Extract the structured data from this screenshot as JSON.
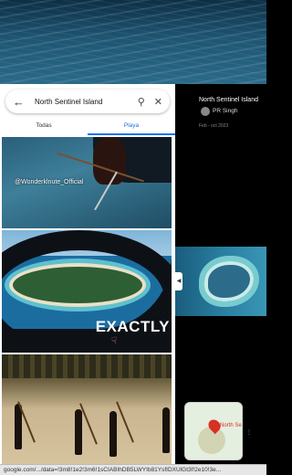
{
  "search": {
    "query": "North Sentinel Island",
    "back_icon": "arrow-left-icon",
    "search_icon": "search-icon",
    "close_icon": "close-icon"
  },
  "tabs": [
    {
      "label": "Todas",
      "active": false
    },
    {
      "label": "Playa",
      "active": true
    }
  ],
  "images": {
    "first_watermark": "@Wonderklnute_Official",
    "second_caption": "EXACTLY"
  },
  "side_panel": {
    "title": "North Sentinel Island",
    "author": "PR Singh",
    "date": "Feb - oct 2023"
  },
  "map": {
    "label": "North Se"
  },
  "url": "google.com/.../data=!3m8!1e2!3m6!1sCIABIhDB5LWYIb81YsfIDXUlGt3f!2e10!3e...",
  "colors": {
    "accent": "#1a73e8",
    "pin": "#d93025"
  }
}
